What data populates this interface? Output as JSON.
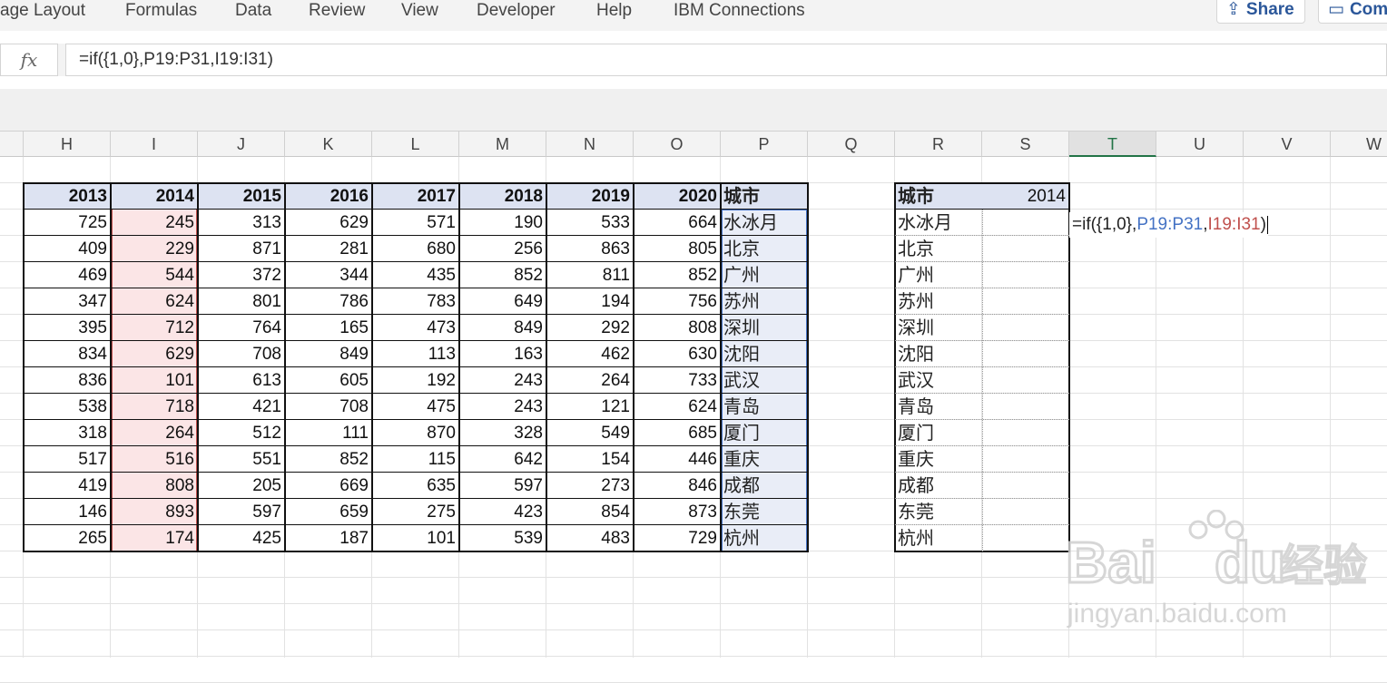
{
  "ribbon": {
    "tabs": [
      "age Layout",
      "Formulas",
      "Data",
      "Review",
      "View",
      "Developer",
      "Help",
      "IBM Connections"
    ],
    "share_label": "Share",
    "comments_label": "Comm"
  },
  "formula_bar": {
    "fx_label": "fx",
    "formula": "=if({1,0},P19:P31,I19:I31)"
  },
  "columns": [
    "H",
    "I",
    "J",
    "K",
    "L",
    "M",
    "N",
    "O",
    "P",
    "Q",
    "R",
    "S",
    "T",
    "U",
    "V",
    "W"
  ],
  "selected_column": "T",
  "left_table": {
    "headers": [
      "2013",
      "2014",
      "2015",
      "2016",
      "2017",
      "2018",
      "2019",
      "2020",
      "城市"
    ],
    "rows": [
      [
        "725",
        "245",
        "313",
        "629",
        "571",
        "190",
        "533",
        "664",
        "水冰月"
      ],
      [
        "409",
        "229",
        "871",
        "281",
        "680",
        "256",
        "863",
        "805",
        "北京"
      ],
      [
        "469",
        "544",
        "372",
        "344",
        "435",
        "852",
        "811",
        "852",
        "广州"
      ],
      [
        "347",
        "624",
        "801",
        "786",
        "783",
        "649",
        "194",
        "756",
        "苏州"
      ],
      [
        "395",
        "712",
        "764",
        "165",
        "473",
        "849",
        "292",
        "808",
        "深圳"
      ],
      [
        "834",
        "629",
        "708",
        "849",
        "113",
        "163",
        "462",
        "630",
        "沈阳"
      ],
      [
        "836",
        "101",
        "613",
        "605",
        "192",
        "243",
        "264",
        "733",
        "武汉"
      ],
      [
        "538",
        "718",
        "421",
        "708",
        "475",
        "243",
        "121",
        "624",
        "青岛"
      ],
      [
        "318",
        "264",
        "512",
        "111",
        "870",
        "328",
        "549",
        "685",
        "厦门"
      ],
      [
        "517",
        "516",
        "551",
        "852",
        "115",
        "642",
        "154",
        "446",
        "重庆"
      ],
      [
        "419",
        "808",
        "205",
        "669",
        "635",
        "597",
        "273",
        "846",
        "成都"
      ],
      [
        "146",
        "893",
        "597",
        "659",
        "275",
        "423",
        "854",
        "873",
        "东莞"
      ],
      [
        "265",
        "174",
        "425",
        "187",
        "101",
        "539",
        "483",
        "729",
        "杭州"
      ]
    ]
  },
  "right_table": {
    "header_city": "城市",
    "header_year": "2014",
    "cities": [
      "水冰月",
      "北京",
      "广州",
      "苏州",
      "深圳",
      "沈阳",
      "武汉",
      "青岛",
      "厦门",
      "重庆",
      "成都",
      "东莞",
      "杭州"
    ]
  },
  "edit_cell": {
    "part1": "=if({1,0},",
    "ref1": "P19:P31",
    "comma": ",",
    "ref2": "I19:I31",
    "close": ")"
  },
  "watermark": {
    "brand": "Bai",
    "brand2": "du",
    "brand_cn": "经验",
    "url": "jingyan.baidu.com"
  },
  "colors": {
    "header_fill": "#dde3f2",
    "ref1_color": "#4472c4",
    "ref2_color": "#c0504d",
    "excel_green": "#217346"
  }
}
